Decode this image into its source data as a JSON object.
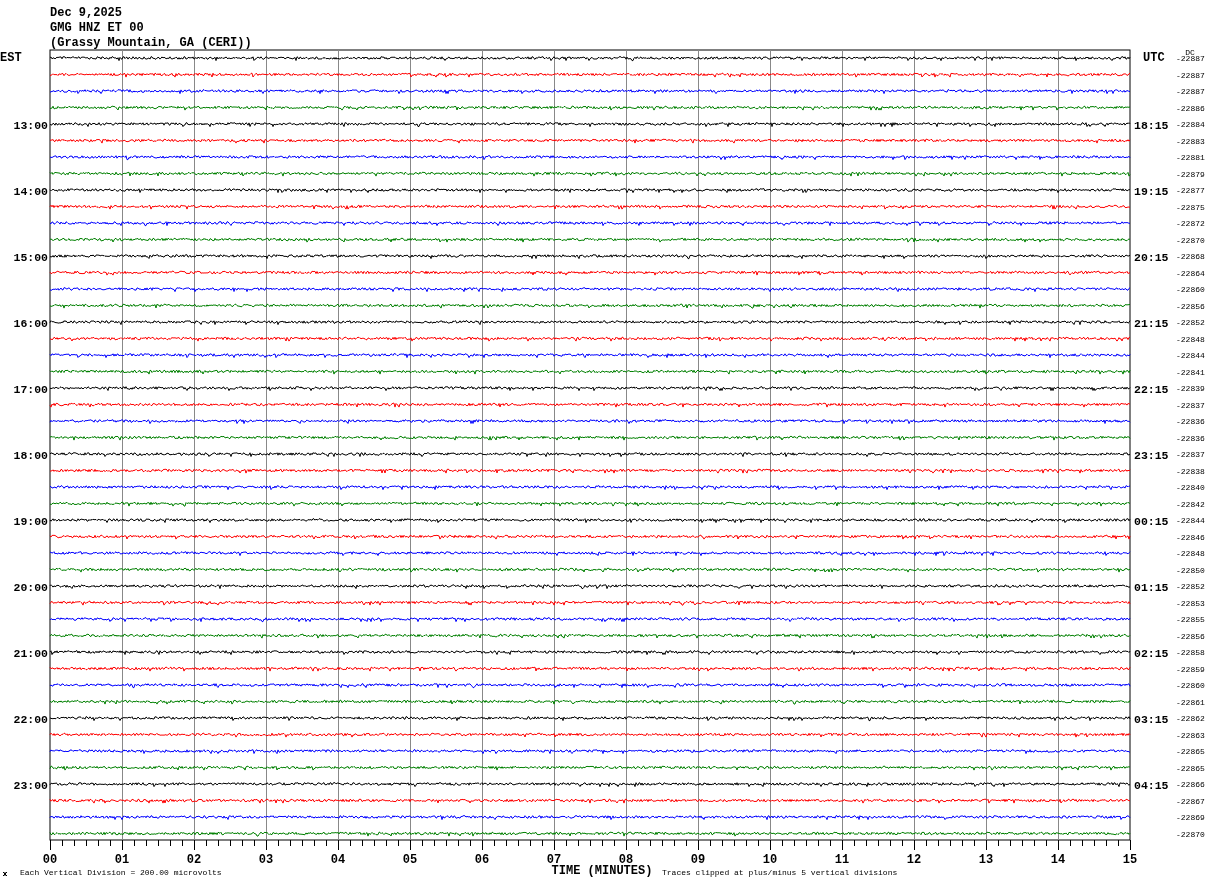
{
  "header": {
    "date": "Dec 9,2025",
    "station": "GMG HNZ ET 00",
    "location": "(Grassy Mountain, GA (CERI))"
  },
  "left_zone": "EST",
  "right_zone": "UTC",
  "dc_header": "DC",
  "traces": [
    {
      "dc": "-22887",
      "color": "#000000"
    },
    {
      "dc": "-22887",
      "color": "#ff0000"
    },
    {
      "dc": "-22887",
      "color": "#0000ff"
    },
    {
      "dc": "-22886",
      "color": "#008000"
    },
    {
      "est": "13:00",
      "utc": "18:15",
      "dc": "-22884",
      "color": "#000000"
    },
    {
      "dc": "-22883",
      "color": "#ff0000"
    },
    {
      "dc": "-22881",
      "color": "#0000ff"
    },
    {
      "dc": "-22879",
      "color": "#008000"
    },
    {
      "est": "14:00",
      "utc": "19:15",
      "dc": "-22877",
      "color": "#000000"
    },
    {
      "dc": "-22875",
      "color": "#ff0000"
    },
    {
      "dc": "-22872",
      "color": "#0000ff"
    },
    {
      "dc": "-22870",
      "color": "#008000"
    },
    {
      "est": "15:00",
      "utc": "20:15",
      "dc": "-22868",
      "color": "#000000"
    },
    {
      "dc": "-22864",
      "color": "#ff0000"
    },
    {
      "dc": "-22860",
      "color": "#0000ff"
    },
    {
      "dc": "-22856",
      "color": "#008000"
    },
    {
      "est": "16:00",
      "utc": "21:15",
      "dc": "-22852",
      "color": "#000000"
    },
    {
      "dc": "-22848",
      "color": "#ff0000"
    },
    {
      "dc": "-22844",
      "color": "#0000ff"
    },
    {
      "dc": "-22841",
      "color": "#008000"
    },
    {
      "est": "17:00",
      "utc": "22:15",
      "dc": "-22839",
      "color": "#000000"
    },
    {
      "dc": "-22837",
      "color": "#ff0000"
    },
    {
      "dc": "-22836",
      "color": "#0000ff"
    },
    {
      "dc": "-22836",
      "color": "#008000"
    },
    {
      "est": "18:00",
      "utc": "23:15",
      "dc": "-22837",
      "color": "#000000"
    },
    {
      "dc": "-22838",
      "color": "#ff0000"
    },
    {
      "dc": "-22840",
      "color": "#0000ff"
    },
    {
      "dc": "-22842",
      "color": "#008000"
    },
    {
      "est": "19:00",
      "utc": "00:15",
      "dc": "-22844",
      "color": "#000000"
    },
    {
      "dc": "-22846",
      "color": "#ff0000"
    },
    {
      "dc": "-22848",
      "color": "#0000ff"
    },
    {
      "dc": "-22850",
      "color": "#008000"
    },
    {
      "est": "20:00",
      "utc": "01:15",
      "dc": "-22852",
      "color": "#000000"
    },
    {
      "dc": "-22853",
      "color": "#ff0000"
    },
    {
      "dc": "-22855",
      "color": "#0000ff"
    },
    {
      "dc": "-22856",
      "color": "#008000"
    },
    {
      "est": "21:00",
      "utc": "02:15",
      "dc": "-22858",
      "color": "#000000"
    },
    {
      "dc": "-22859",
      "color": "#ff0000"
    },
    {
      "dc": "-22860",
      "color": "#0000ff"
    },
    {
      "dc": "-22861",
      "color": "#008000"
    },
    {
      "est": "22:00",
      "utc": "03:15",
      "dc": "-22862",
      "color": "#000000"
    },
    {
      "dc": "-22863",
      "color": "#ff0000"
    },
    {
      "dc": "-22865",
      "color": "#0000ff"
    },
    {
      "dc": "-22865",
      "color": "#008000"
    },
    {
      "est": "23:00",
      "utc": "04:15",
      "dc": "-22866",
      "color": "#000000"
    },
    {
      "dc": "-22867",
      "color": "#ff0000"
    },
    {
      "dc": "-22869",
      "color": "#0000ff"
    },
    {
      "dc": "-22870",
      "color": "#008000"
    }
  ],
  "x_axis": {
    "ticks": [
      "00",
      "01",
      "02",
      "03",
      "04",
      "05",
      "06",
      "07",
      "08",
      "09",
      "10",
      "11",
      "12",
      "13",
      "14",
      "15"
    ],
    "title": "TIME (MINUTES)"
  },
  "footer": {
    "scale": "Each Vertical Division =  200.00 microvolts",
    "clip": "Traces clipped at plus/minus 5 vertical divisions"
  }
}
